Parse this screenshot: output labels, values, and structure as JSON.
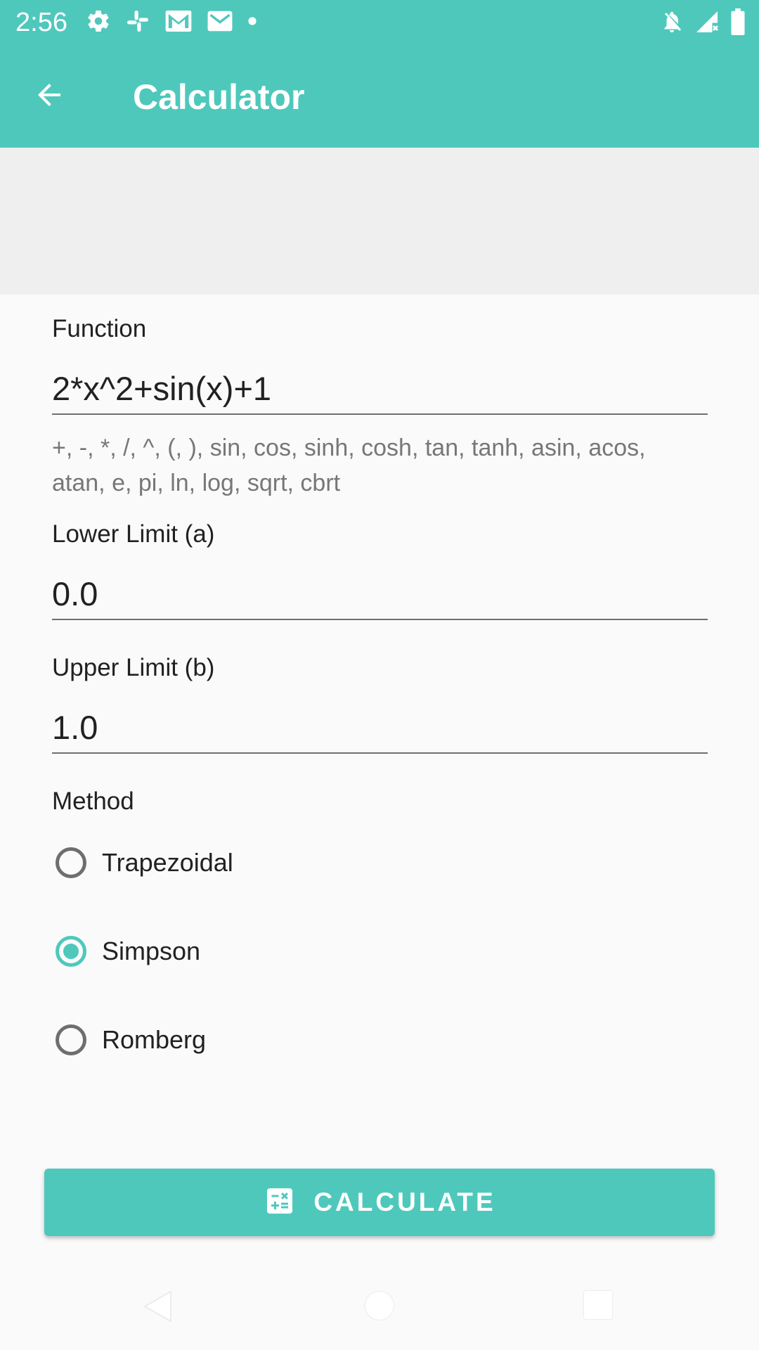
{
  "status_bar": {
    "time": "2:56",
    "left_icons": [
      "gear-icon",
      "slack-icon",
      "gmail-icon",
      "gmail-icon",
      "dot-icon"
    ],
    "right_icons": [
      "notifications-off-icon",
      "signal-icon",
      "battery-icon"
    ]
  },
  "app_bar": {
    "title": "Calculator",
    "back_icon": "arrow-back-icon",
    "color": "#4FC8BC"
  },
  "form": {
    "function": {
      "label": "Function",
      "value": "2*x^2+sin(x)+1",
      "helper_line1": "+, -, *, /, ^, (, ), sin, cos, sinh, cosh, tan, tanh, asin, acos,",
      "helper_line2": "atan, e, pi, ln, log, sqrt, cbrt"
    },
    "lower_limit": {
      "label": "Lower Limit (a)",
      "value": "0.0"
    },
    "upper_limit": {
      "label": "Upper Limit (b)",
      "value": "1.0"
    },
    "method": {
      "label": "Method",
      "options": [
        {
          "label": "Trapezoidal",
          "checked": false
        },
        {
          "label": "Simpson",
          "checked": true
        },
        {
          "label": "Romberg",
          "checked": false
        }
      ]
    }
  },
  "calculate_button": {
    "label": "CALCULATE",
    "icon": "calculator-icon"
  },
  "nav_bar": {
    "icons": [
      "nav-back-icon",
      "nav-home-icon",
      "nav-recents-icon"
    ]
  }
}
